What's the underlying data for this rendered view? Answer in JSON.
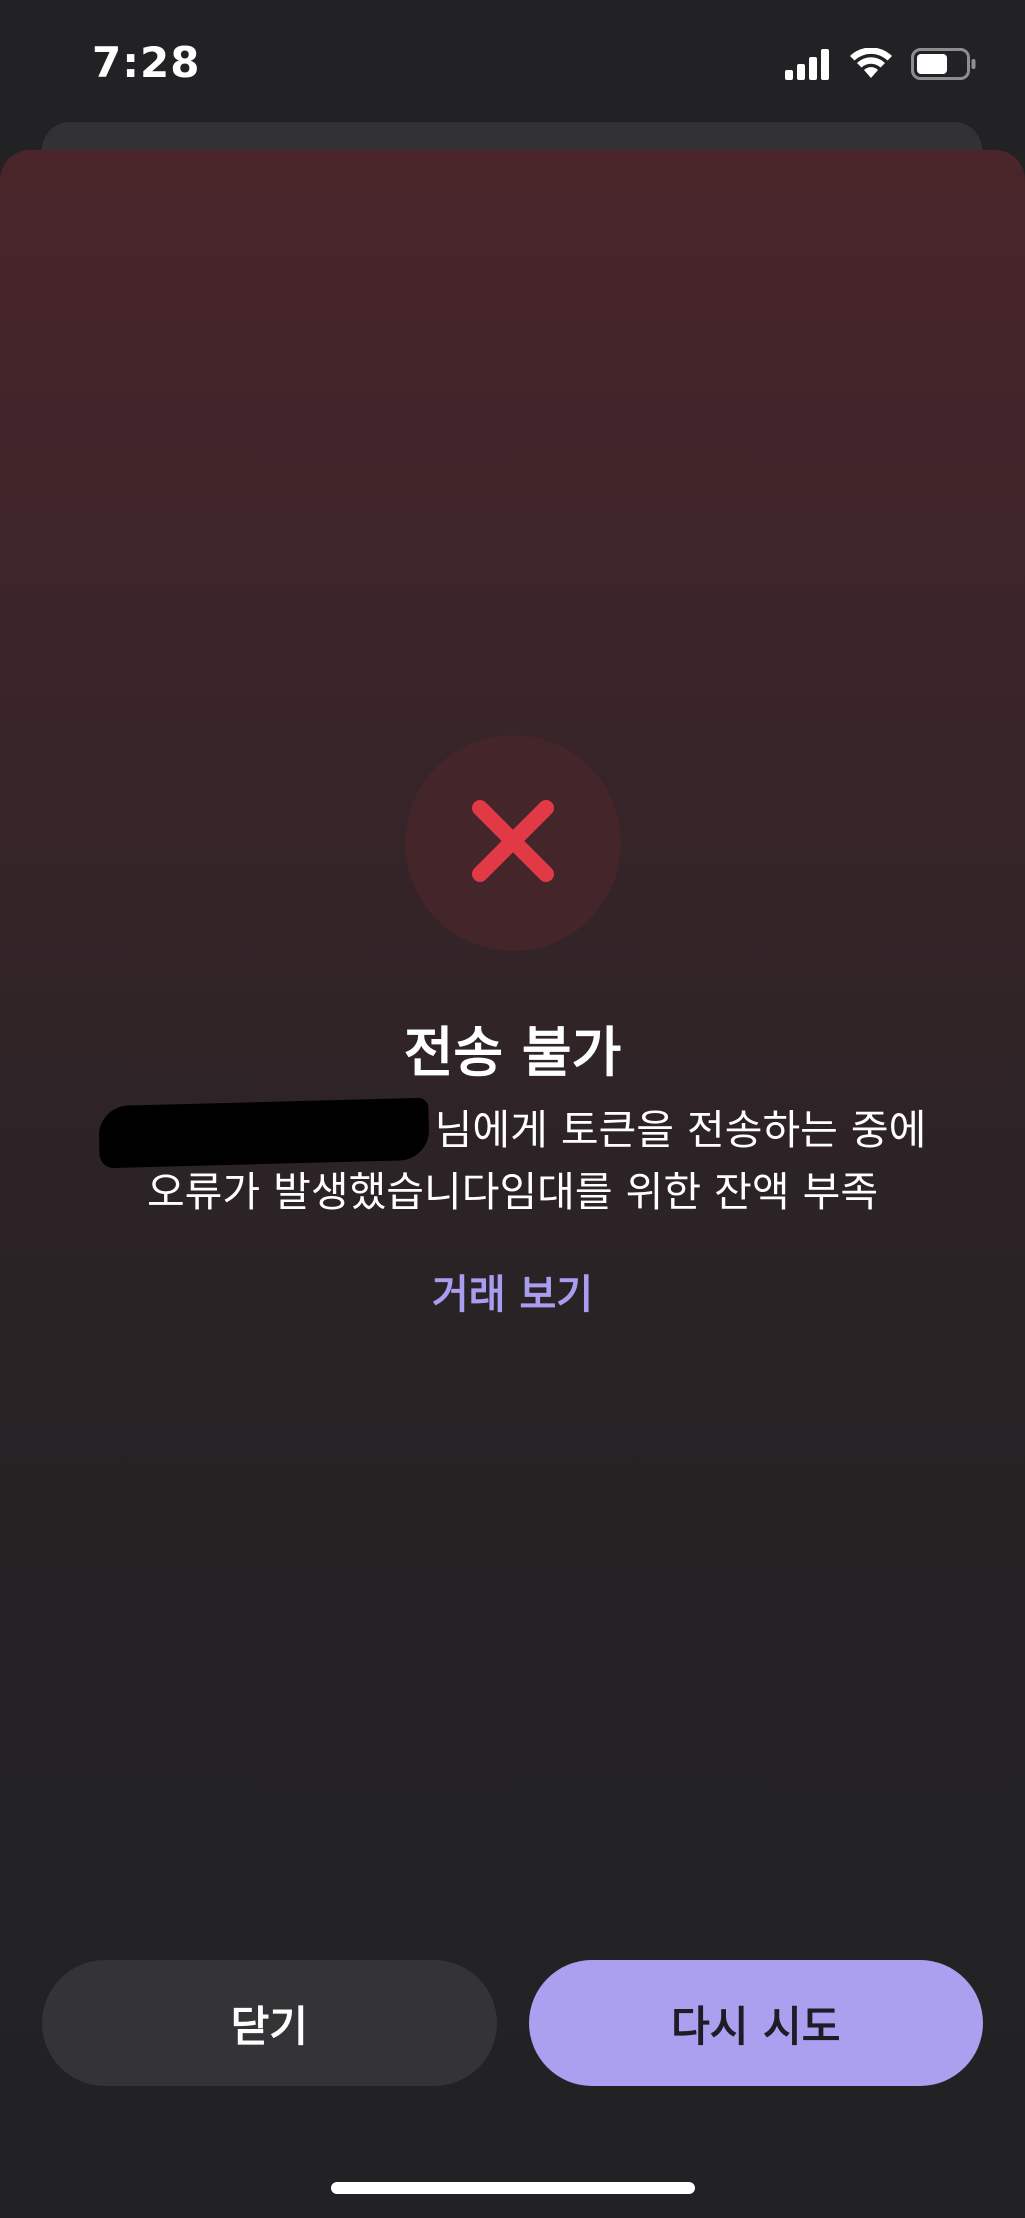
{
  "status_bar": {
    "time": "7:28",
    "signal_icon": "cellular-signal-icon",
    "wifi_icon": "wifi-icon",
    "battery_icon": "battery-icon"
  },
  "dialog": {
    "icon": "error-x-icon",
    "icon_color": "#e23946",
    "title": "전송 불가",
    "message_line1_suffix": "님에게 토큰을 전송하는 중에",
    "message_line2": "오류가 발생했습니다임대를 위한 잔액 부족",
    "view_transaction_label": "거래 보기",
    "accent_color": "#a89dee"
  },
  "buttons": {
    "close_label": "닫기",
    "retry_label": "다시 시도"
  }
}
